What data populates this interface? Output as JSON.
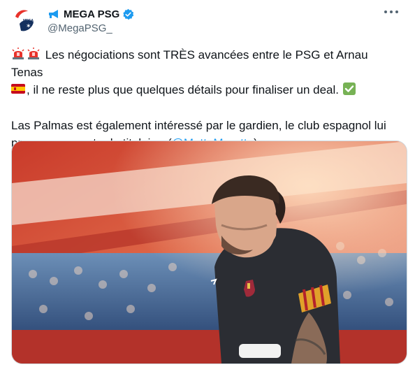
{
  "account": {
    "display_name": "MEGA PSG",
    "handle": "@MegaPSG_",
    "verified": true,
    "avatar_icon": "mega-logo",
    "name_icon": "megaphone-icon",
    "accent_color": "#1d9bf0"
  },
  "tweet": {
    "line1_text": "Les négociations sont TRÈS avancées entre le PSG et Arnau Tenas",
    "line2_text": ", il ne reste plus que quelques détails pour finaliser un deal.",
    "para2_text": "Las Palmas est également intéressé par le gardien, le club espagnol lui propose un poste de titulaire. (",
    "mention": "@MatteMoretto",
    "para2_end": ")",
    "emojis": [
      "siren-icon",
      "siren-icon",
      "spain-flag-icon",
      "check-mark-icon"
    ]
  },
  "media": {
    "kind": "photo",
    "subject": "goalkeeper-photo"
  }
}
